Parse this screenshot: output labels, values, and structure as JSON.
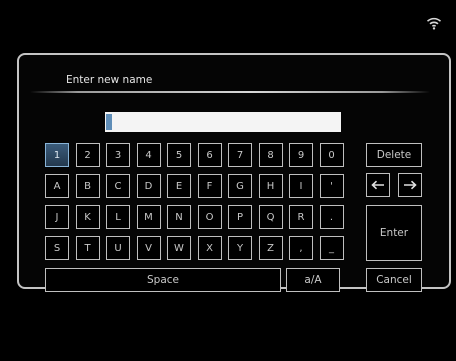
{
  "status": {
    "wifi_icon": "wifi-icon"
  },
  "dialog": {
    "title": "Enter new name",
    "input_value": "",
    "rows": [
      [
        "1",
        "2",
        "3",
        "4",
        "5",
        "6",
        "7",
        "8",
        "9",
        "0"
      ],
      [
        "A",
        "B",
        "C",
        "D",
        "E",
        "F",
        "G",
        "H",
        "I",
        "'"
      ],
      [
        "J",
        "K",
        "L",
        "M",
        "N",
        "O",
        "P",
        "Q",
        "R",
        "."
      ],
      [
        "S",
        "T",
        "U",
        "V",
        "W",
        "X",
        "Y",
        "Z",
        ",",
        "_"
      ]
    ],
    "selected_key": "1",
    "space_label": "Space",
    "case_label": "a/A",
    "delete_label": "Delete",
    "enter_label": "Enter",
    "cancel_label": "Cancel",
    "left_arrow_icon": "arrow-left-icon",
    "right_arrow_icon": "arrow-right-icon"
  },
  "colors": {
    "selected_key": "#3b5c7b",
    "cursor": "#5f8db7"
  }
}
